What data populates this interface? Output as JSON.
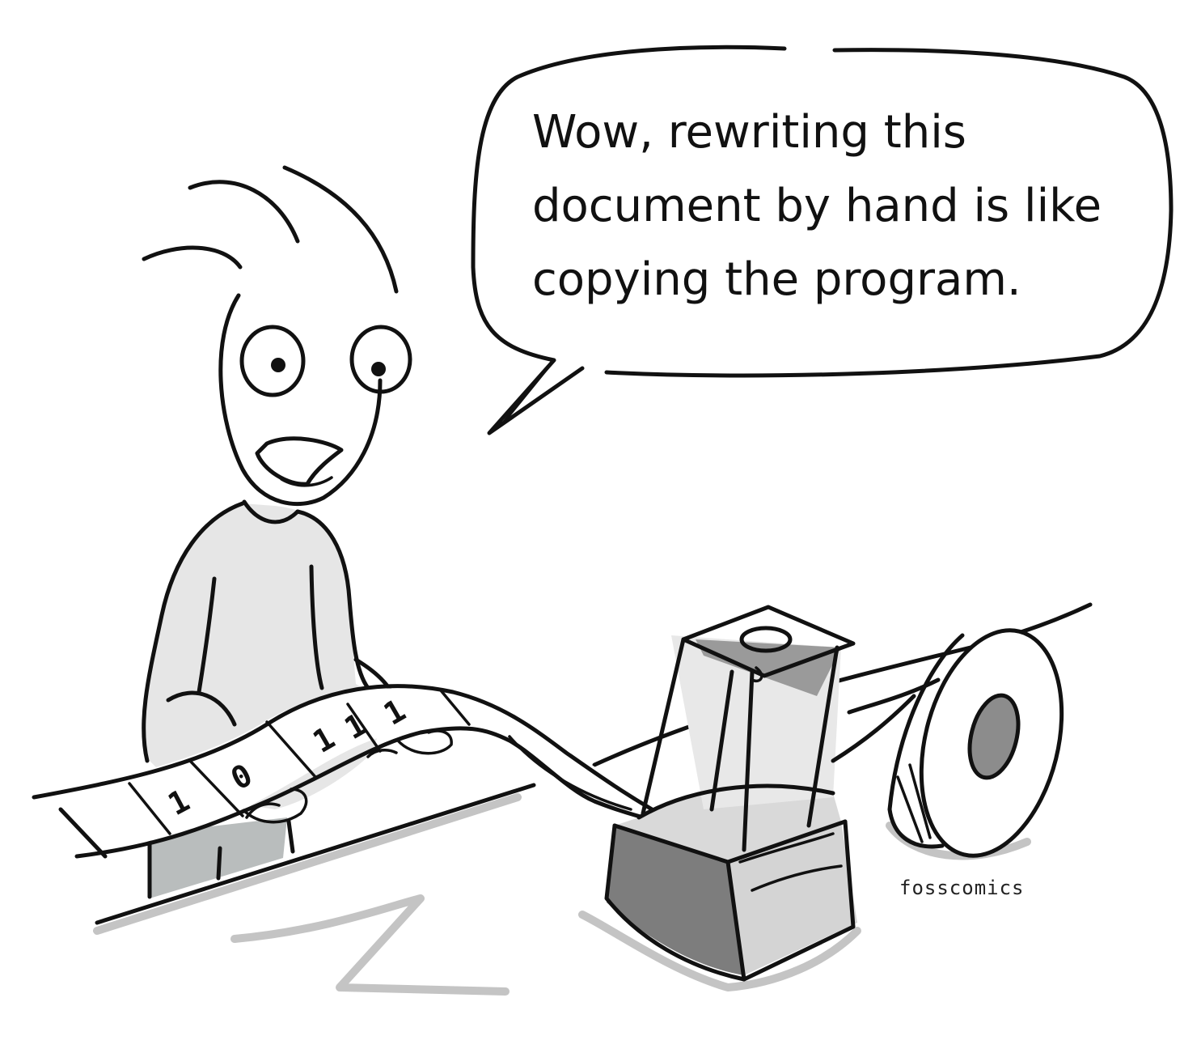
{
  "speech_bubble": {
    "lines": [
      "Wow, rewriting this",
      "document by hand is like",
      "copying the program."
    ]
  },
  "signature": "fosscomics",
  "tape": {
    "digits": [
      "1",
      "0",
      "1",
      "1",
      "1"
    ]
  },
  "colors": {
    "ink": "#111111",
    "shirt": "#e6e6e6",
    "pants": "#b9bdbd",
    "machine_dark": "#7d7d7d",
    "machine_light": "#d4d4d4",
    "shadow": "#c4c4c4"
  }
}
